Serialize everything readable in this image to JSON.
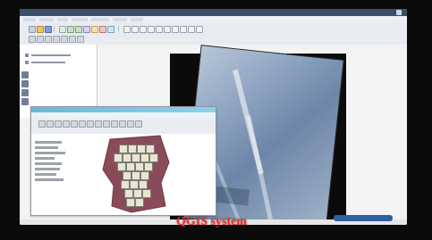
{
  "caption": "QGIS system",
  "status": {
    "bubble_text": ""
  },
  "screen": {
    "theme": {
      "title_bar": "#3a4e6a",
      "toolbar_bg": "#e8ebf0",
      "panel_bg": "#ffffff",
      "subwindow_title": "#6db7d8",
      "polygon_fill": "#8a4b58",
      "grid_fill": "#e9e5cf",
      "caption_red": "#ff2b2b"
    },
    "icons": [
      "new-project-icon",
      "open-icon",
      "save-icon",
      "print-icon",
      "pan-icon",
      "zoom-in-icon",
      "zoom-out-icon",
      "identify-icon",
      "select-icon",
      "measure-icon",
      "add-layer-icon"
    ]
  }
}
